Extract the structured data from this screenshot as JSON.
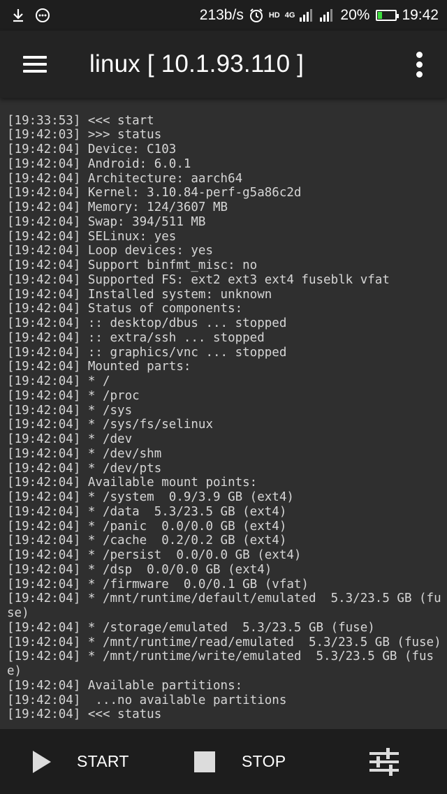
{
  "status_bar": {
    "left_icons": [
      "download-icon",
      "more-circle-icon"
    ],
    "net_speed": "213b/s",
    "alarm_icon": "alarm-clock-icon",
    "hd_label": "HD",
    "network_label": "4G",
    "battery_percent": "20%",
    "battery_level": 0.2,
    "battery_color": "#3ddc3d",
    "time": "19:42"
  },
  "toolbar": {
    "menu_icon": "hamburger-menu-icon",
    "title": "linux  [ 10.1.93.110 ]",
    "overflow_icon": "overflow-menu-icon"
  },
  "console": {
    "lines": [
      "[19:33:53] <<< start",
      "[19:42:03] >>> status",
      "[19:42:04] Device: C103",
      "[19:42:04] Android: 6.0.1",
      "[19:42:04] Architecture: aarch64",
      "[19:42:04] Kernel: 3.10.84-perf-g5a86c2d",
      "[19:42:04] Memory: 124/3607 MB",
      "[19:42:04] Swap: 394/511 MB",
      "[19:42:04] SELinux: yes",
      "[19:42:04] Loop devices: yes",
      "[19:42:04] Support binfmt_misc: no",
      "[19:42:04] Supported FS: ext2 ext3 ext4 fuseblk vfat",
      "[19:42:04] Installed system: unknown",
      "[19:42:04] Status of components:",
      "[19:42:04] :: desktop/dbus ... stopped",
      "[19:42:04] :: extra/ssh ... stopped",
      "[19:42:04] :: graphics/vnc ... stopped",
      "[19:42:04] Mounted parts:",
      "[19:42:04] * /",
      "[19:42:04] * /proc",
      "[19:42:04] * /sys",
      "[19:42:04] * /sys/fs/selinux",
      "[19:42:04] * /dev",
      "[19:42:04] * /dev/shm",
      "[19:42:04] * /dev/pts",
      "[19:42:04] Available mount points:",
      "[19:42:04] * /system  0.9/3.9 GB (ext4)",
      "[19:42:04] * /data  5.3/23.5 GB (ext4)",
      "[19:42:04] * /panic  0.0/0.0 GB (ext4)",
      "[19:42:04] * /cache  0.2/0.2 GB (ext4)",
      "[19:42:04] * /persist  0.0/0.0 GB (ext4)",
      "[19:42:04] * /dsp  0.0/0.0 GB (ext4)",
      "[19:42:04] * /firmware  0.0/0.1 GB (vfat)",
      "[19:42:04] * /mnt/runtime/default/emulated  5.3/23.5 GB (fuse)",
      "[19:42:04] * /storage/emulated  5.3/23.5 GB (fuse)",
      "[19:42:04] * /mnt/runtime/read/emulated  5.3/23.5 GB (fuse)",
      "[19:42:04] * /mnt/runtime/write/emulated  5.3/23.5 GB (fuse)",
      "[19:42:04] Available partitions:",
      "[19:42:04]  ...no available partitions",
      "[19:42:04] <<< status"
    ]
  },
  "bottom_bar": {
    "start_label": "START",
    "start_icon": "play-icon",
    "stop_label": "STOP",
    "stop_icon": "stop-icon",
    "settings_icon": "settings-sliders-icon"
  }
}
